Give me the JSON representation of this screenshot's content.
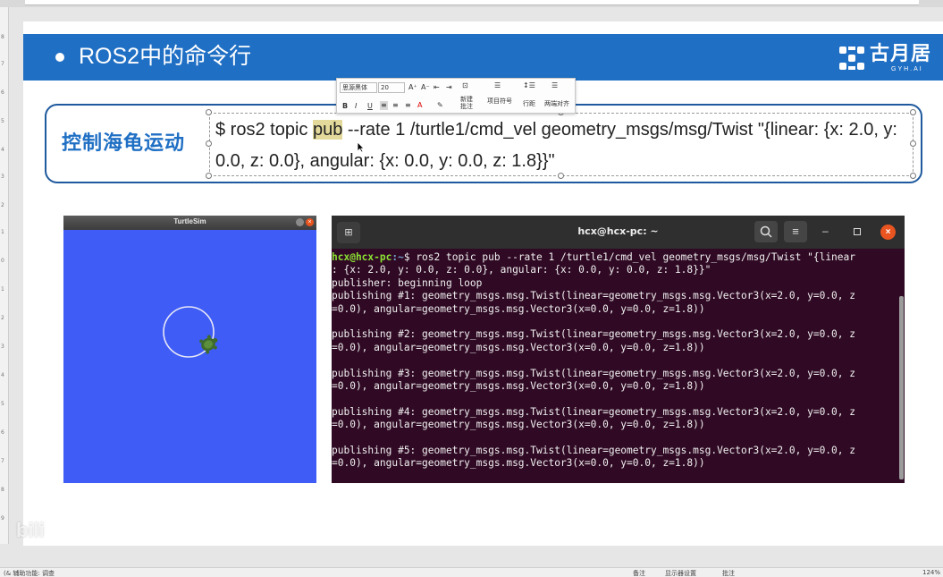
{
  "slide": {
    "title": "ROS2中的命令行",
    "logo_text": "古月居",
    "logo_sub": "GYH.AI"
  },
  "command_box": {
    "label": "控制海龟运动",
    "text_before": "$ ros2 topic ",
    "text_highlight": "pub",
    "text_after": " --rate 1 /turtle1/cmd_vel geometry_msgs/msg/Twist \"{linear: {x: 2.0, y: 0.0, z: 0.0}, angular: {x: 0.0, y: 0.0, z: 1.8}}\""
  },
  "mini_toolbar": {
    "font": "思源黑体",
    "size": "20",
    "new_comment": "新建批注",
    "bullets": "项目符号",
    "line_spacing": "行距",
    "justify": "两端对齐"
  },
  "turtlesim": {
    "title": "TurtleSim",
    "bg_color": "#3f5cf6"
  },
  "terminal": {
    "title": "hcx@hcx-pc: ~",
    "prompt_user": "hcx@hcx-pc",
    "prompt_path": ":~",
    "command": "$ ros2 topic pub --rate 1 /turtle1/cmd_vel geometry_msgs/msg/Twist \"{linear",
    "lines": [
      ": {x: 2.0, y: 0.0, z: 0.0}, angular: {x: 0.0, y: 0.0, z: 1.8}}\"",
      "publisher: beginning loop",
      "publishing #1: geometry_msgs.msg.Twist(linear=geometry_msgs.msg.Vector3(x=2.0, y=0.0, z",
      "=0.0), angular=geometry_msgs.msg.Vector3(x=0.0, y=0.0, z=1.8))",
      "",
      "publishing #2: geometry_msgs.msg.Twist(linear=geometry_msgs.msg.Vector3(x=2.0, y=0.0, z",
      "=0.0), angular=geometry_msgs.msg.Vector3(x=0.0, y=0.0, z=1.8))",
      "",
      "publishing #3: geometry_msgs.msg.Twist(linear=geometry_msgs.msg.Vector3(x=2.0, y=0.0, z",
      "=0.0), angular=geometry_msgs.msg.Vector3(x=0.0, y=0.0, z=1.8))",
      "",
      "publishing #4: geometry_msgs.msg.Twist(linear=geometry_msgs.msg.Vector3(x=2.0, y=0.0, z",
      "=0.0), angular=geometry_msgs.msg.Vector3(x=0.0, y=0.0, z=1.8))",
      "",
      "publishing #5: geometry_msgs.msg.Twist(linear=geometry_msgs.msg.Vector3(x=2.0, y=0.0, z",
      "=0.0), angular=geometry_msgs.msg.Vector3(x=0.0, y=0.0, z=1.8))"
    ]
  },
  "statusbar": {
    "left": "(& 辅助功能: 调查",
    "notes": "备注",
    "display": "显示器设置",
    "comments": "批注",
    "zoom": "124%"
  }
}
